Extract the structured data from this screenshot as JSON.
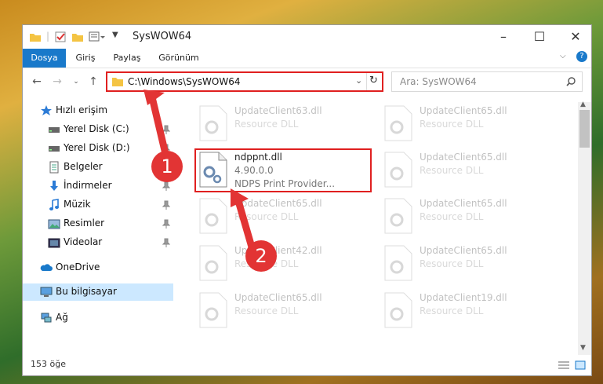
{
  "window": {
    "title": "SysWOW64"
  },
  "ribbon": {
    "tabs": [
      "Dosya",
      "Giriş",
      "Paylaş",
      "Görünüm"
    ]
  },
  "address": {
    "path": "C:\\Windows\\SysWOW64",
    "search_placeholder": "Ara: SysWOW64"
  },
  "sidebar": {
    "items": [
      {
        "label": "Hızlı erişim",
        "icon": "star-icon"
      },
      {
        "label": "Yerel Disk (C:)",
        "icon": "drive-icon"
      },
      {
        "label": "Yerel Disk (D:)",
        "icon": "drive-icon"
      },
      {
        "label": "Belgeler",
        "icon": "documents-icon"
      },
      {
        "label": "İndirmeler",
        "icon": "download-icon"
      },
      {
        "label": "Müzik",
        "icon": "music-icon"
      },
      {
        "label": "Resimler",
        "icon": "pictures-icon"
      },
      {
        "label": "Videolar",
        "icon": "videos-icon"
      },
      {
        "label": "OneDrive",
        "icon": "cloud-icon"
      },
      {
        "label": "Bu bilgisayar",
        "icon": "computer-icon"
      },
      {
        "label": "Ağ",
        "icon": "network-icon"
      }
    ]
  },
  "files": {
    "highlighted": {
      "name": "ndppnt.dll",
      "version": "4.90.0.0",
      "desc": "NDPS Print Provider..."
    },
    "left": [
      {
        "name": "UpdateClient63.dll",
        "desc": "Resource DLL"
      },
      {
        "name": "UpdateClient65.dll",
        "desc": "Resource DLL"
      },
      {
        "name": "UpdateClient42.dll",
        "desc": "Resource DLL"
      },
      {
        "name": "UpdateClient65.dll",
        "desc": "Resource DLL"
      }
    ],
    "right": [
      {
        "name": "UpdateClient65.dll",
        "desc": "Resource DLL"
      },
      {
        "name": "UpdateClient65.dll",
        "desc": "Resource DLL"
      },
      {
        "name": "UpdateClient65.dll",
        "desc": "Resource DLL"
      },
      {
        "name": "UpdateClient65.dll",
        "desc": "Resource DLL"
      },
      {
        "name": "UpdateClient19.dll",
        "desc": "Resource DLL"
      }
    ]
  },
  "status": {
    "count": "153 öğe"
  },
  "markers": [
    "1",
    "2"
  ],
  "colors": {
    "accent": "#1979ca",
    "highlight": "#e02020",
    "selection": "#cce8ff"
  }
}
